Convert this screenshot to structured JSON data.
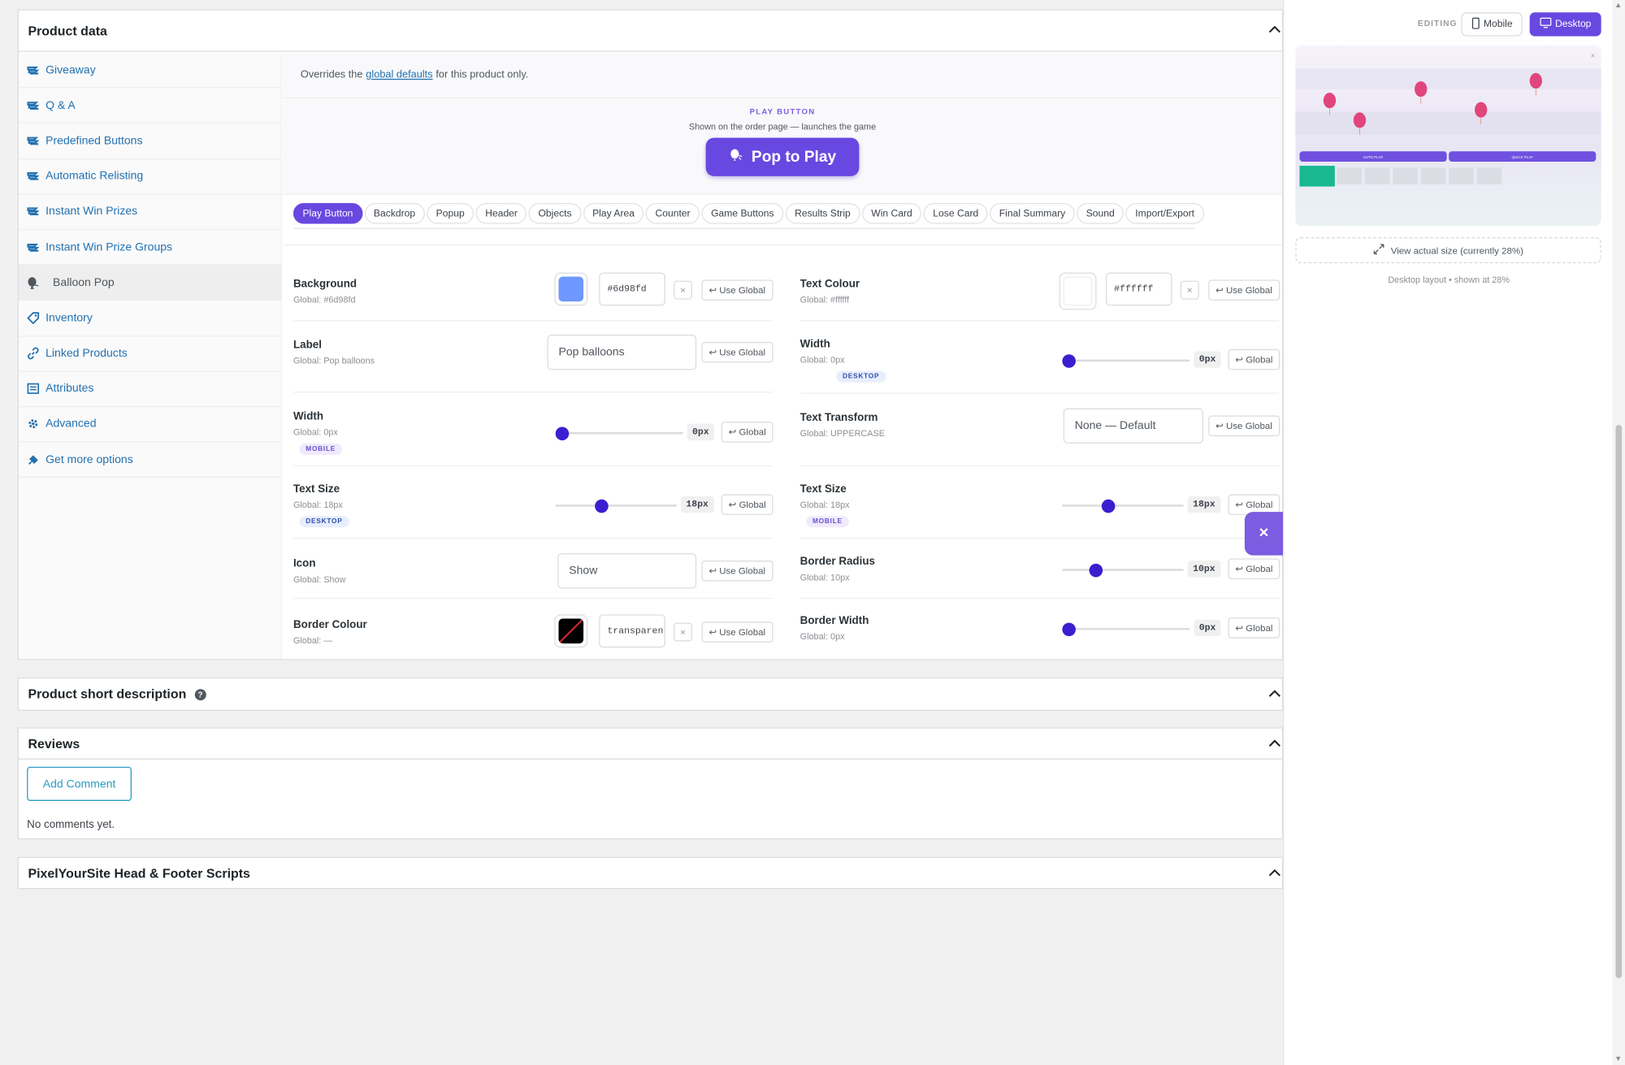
{
  "product_data": {
    "title": "Product data",
    "tabs": [
      {
        "label": "Giveaway",
        "icon": "gear-icon"
      },
      {
        "label": "Q & A",
        "icon": "gear-icon"
      },
      {
        "label": "Predefined Buttons",
        "icon": "gear-icon"
      },
      {
        "label": "Automatic Relisting",
        "icon": "gear-icon"
      },
      {
        "label": "Instant Win Prizes",
        "icon": "gear-icon"
      },
      {
        "label": "Instant Win Prize Groups",
        "icon": "gear-icon"
      },
      {
        "label": "Balloon Pop",
        "icon": "balloon-icon",
        "active": true
      },
      {
        "label": "Inventory",
        "icon": "tag-icon"
      },
      {
        "label": "Linked Products",
        "icon": "link-icon"
      },
      {
        "label": "Attributes",
        "icon": "list-icon"
      },
      {
        "label": "Advanced",
        "icon": "gear-icon"
      },
      {
        "label": "Get more options",
        "icon": "plugin-icon"
      }
    ],
    "overrides": {
      "before": "Overrides the",
      "link": "global defaults",
      "after": "for this product only."
    },
    "play_button": {
      "section_label": "PLAY BUTTON",
      "subtitle": "Shown on the order page — launches the game",
      "button_label": "Pop to Play",
      "button_color": "#6848e0"
    },
    "pills": [
      "Play Button",
      "Backdrop",
      "Popup",
      "Header",
      "Objects",
      "Play Area",
      "Counter",
      "Game Buttons",
      "Results Strip",
      "Win Card",
      "Lose Card",
      "Final Summary",
      "Sound",
      "Import/Export"
    ],
    "fields": {
      "bg": {
        "label": "Background",
        "global": "Global: #6d98fd",
        "hex": "#6d98fd",
        "color": "#6d98fd",
        "action": "Use Global"
      },
      "label": {
        "label": "Label",
        "global": "Global: Pop balloons",
        "placeholder": "Pop balloons",
        "action": "Use Global"
      },
      "width_m": {
        "label": "Width",
        "global": "Global: 0px",
        "badge": "MOBILE",
        "value": "0px",
        "level": 0,
        "action": "Global"
      },
      "size_d": {
        "label": "Text Size",
        "global": "Global: 18px",
        "badge": "DESKTOP",
        "value": "18px",
        "level": 0.38,
        "action": "Global"
      },
      "icon": {
        "label": "Icon",
        "global": "Global: Show",
        "value": "Show",
        "action": "Use Global"
      },
      "bcolor": {
        "label": "Border Colour",
        "global": "Global: —",
        "hex": "transparent",
        "action": "Use Global"
      },
      "tcolor": {
        "label": "Text Colour",
        "global": "Global: #ffffff",
        "hex": "#ffffff",
        "color": "#ffffff",
        "action": "Use Global"
      },
      "width_d": {
        "label": "Width",
        "global": "Global: 0px",
        "badge": "DESKTOP",
        "value": "0px",
        "level": 0,
        "action": "Global"
      },
      "transform": {
        "label": "Text Transform",
        "global": "Global: UPPERCASE",
        "value": "None — Default",
        "action": "Use Global"
      },
      "size_m": {
        "label": "Text Size",
        "global": "Global: 18px",
        "badge": "MOBILE",
        "value": "18px",
        "level": 0.38,
        "action": "Global"
      },
      "radius": {
        "label": "Border Radius",
        "global": "Global: 10px",
        "value": "10px",
        "level": 0.27,
        "action": "Global"
      },
      "bwidth": {
        "label": "Border Width",
        "global": "Global: 0px",
        "value": "0px",
        "level": 0,
        "action": "Global"
      }
    }
  },
  "short_description": {
    "title": "Product short description"
  },
  "reviews": {
    "title": "Reviews",
    "add_button": "Add Comment",
    "empty": "No comments yet."
  },
  "pixelyoursite": {
    "title": "PixelYourSite Head & Footer Scripts"
  },
  "preview": {
    "editing_label": "EDITING",
    "mobile_label": "Mobile",
    "desktop_label": "Desktop",
    "auto_play": "AUTO PLAY",
    "quick_play": "QUICK PLAY",
    "view_actual": "View actual size (currently 28%)",
    "layout_note": "Desktop layout • shown at 28%",
    "accent": "#6848e0"
  },
  "close_fab": "×"
}
